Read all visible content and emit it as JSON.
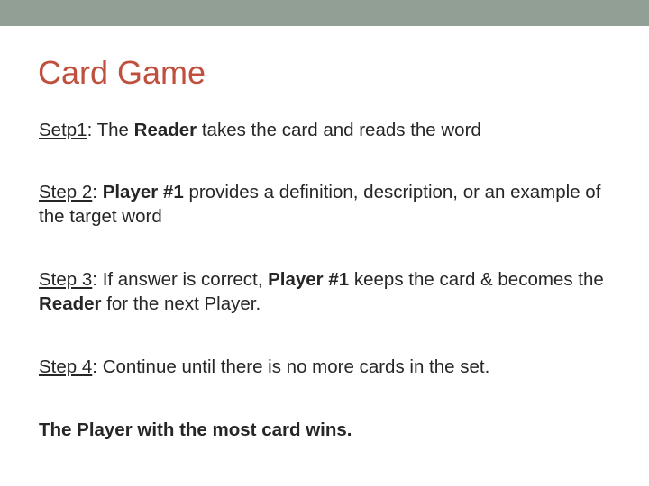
{
  "slide": {
    "title": "Card Game",
    "accent_color": "#c0503e",
    "top_bar_color": "#919f95",
    "steps": [
      {
        "label": "Setp1",
        "sep": ": ",
        "parts": [
          "The ",
          "Reader",
          " takes the card and reads the word"
        ]
      },
      {
        "label": "Step 2",
        "sep": ": ",
        "parts": [
          "Player #1",
          " provides a definition, description, or an example of the target word"
        ]
      },
      {
        "label": "Step 3",
        "sep": ": ",
        "parts": [
          "If answer is correct, ",
          "Player #1",
          " keeps the card & becomes the ",
          "Reader",
          " for the next Player."
        ]
      },
      {
        "label": "Step 4",
        "sep": ": ",
        "parts": [
          "Continue until there is no more cards in the set."
        ]
      }
    ],
    "conclusion": "The Player with the most card wins."
  }
}
